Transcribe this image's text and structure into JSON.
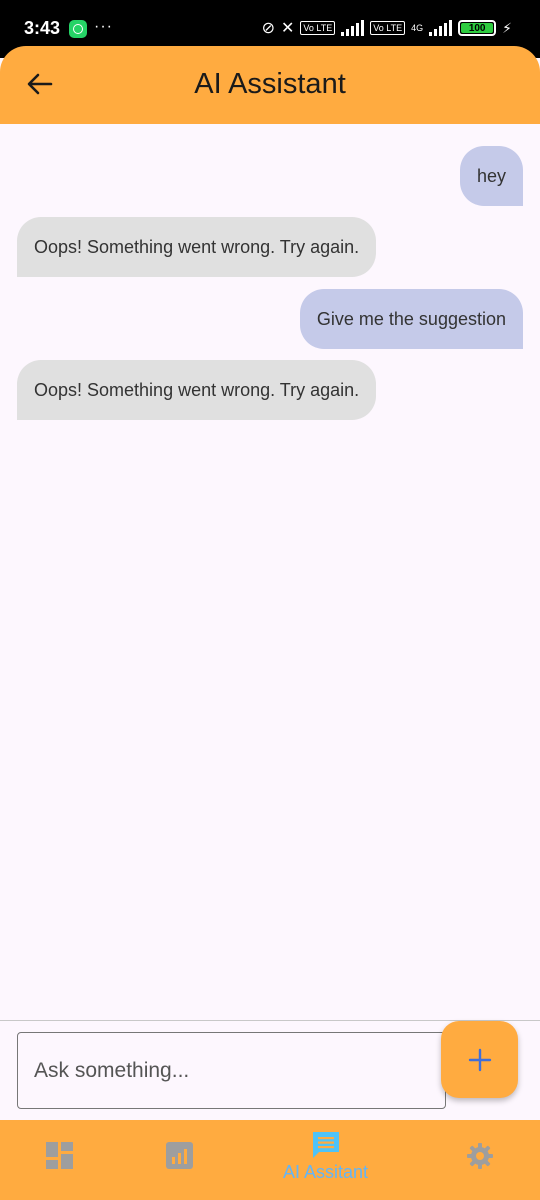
{
  "status_bar": {
    "time": "3:43",
    "dots": "···",
    "volte1": "Vo LTE",
    "volte2": "Vo LTE",
    "network": "4G",
    "battery": "100"
  },
  "app_bar": {
    "title": "AI Assistant"
  },
  "messages": [
    {
      "role": "user",
      "text": "hey"
    },
    {
      "role": "bot",
      "text": "Oops! Something went wrong. Try again."
    },
    {
      "role": "user",
      "text": "Give me the suggestion"
    },
    {
      "role": "bot",
      "text": "Oops! Something went wrong. Try again."
    }
  ],
  "input": {
    "placeholder": "Ask something..."
  },
  "bottom_nav": {
    "active_label": "AI Assitant",
    "items": [
      "dashboard-icon",
      "chart-icon",
      "chat-icon",
      "settings-icon"
    ]
  },
  "colors": {
    "accent": "#ffab40",
    "user_bubble": "#c5cae9",
    "bot_bubble": "#e0e0e0",
    "nav_inactive": "#9e9e9e",
    "nav_active": "#64b5f6"
  }
}
